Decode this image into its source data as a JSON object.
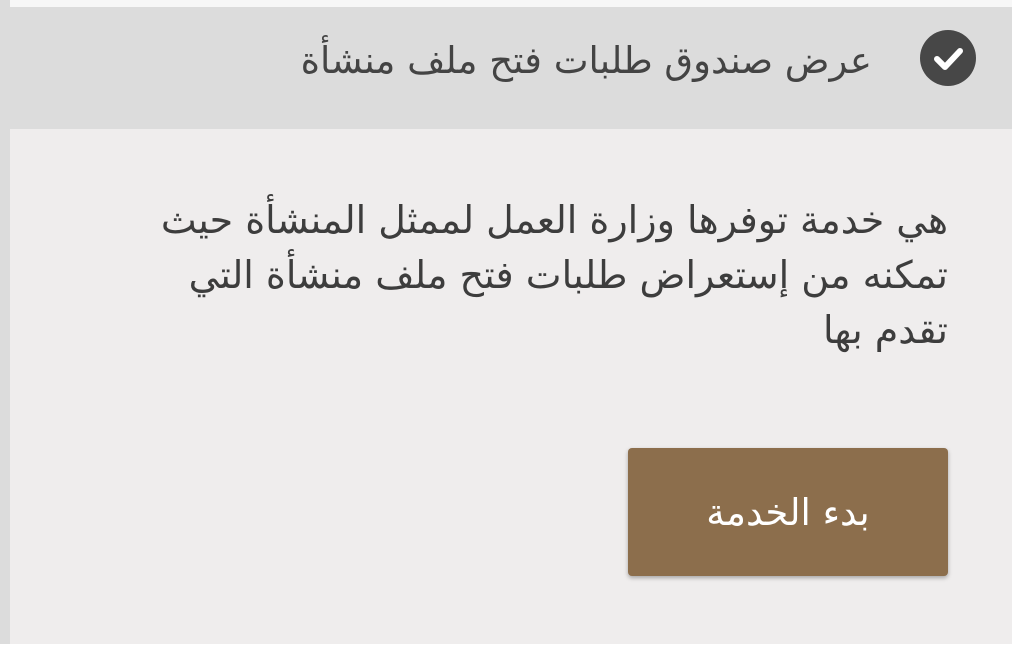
{
  "header": {
    "title": "عرض صندوق طلبات فتح ملف منشأة",
    "icon": "check-circle-icon"
  },
  "description": "هي خدمة توفرها وزارة العمل لممثل المنشأة حيث تمكنه من إستعراض طلبات فتح ملف منشأة التي تقدم بها",
  "start_button": {
    "label": "بدء الخدمة"
  },
  "colors": {
    "header_bg": "#dcdcdc",
    "card_bg": "#efeded",
    "button_bg": "#8c6e4c",
    "icon_bg": "#474747",
    "text": "#3d3d3d"
  }
}
